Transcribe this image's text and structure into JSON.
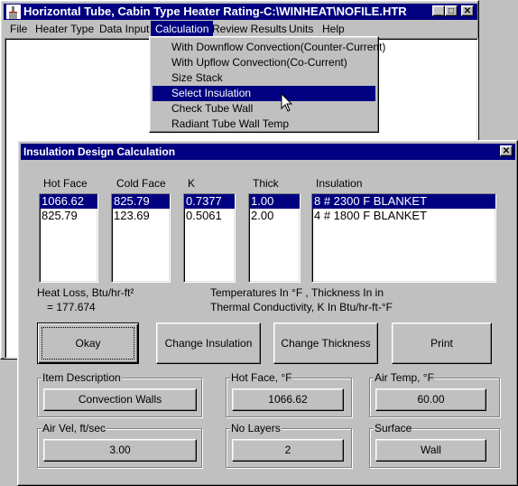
{
  "main_window": {
    "title": "Horizontal Tube, Cabin Type Heater Rating-C:\\WINHEAT\\NOFILE.HTR",
    "controls": {
      "minimize": "_",
      "maximize": "□",
      "close": "✕"
    },
    "menu": [
      "File",
      "Heater Type",
      "Data Input",
      "Calculation",
      "Review Results",
      "Units",
      "Help"
    ],
    "active_menu": "Calculation"
  },
  "calculation_menu": {
    "items": [
      "With Downflow Convection(Counter-Current)",
      "With Upflow Convection(Co-Current)",
      "Size Stack",
      "Select Insulation",
      "Check Tube Wall",
      "Radiant Tube Wall Temp"
    ],
    "selected": "Select Insulation"
  },
  "dialog": {
    "title": "Insulation Design Calculation",
    "close": "✕",
    "columns": {
      "hot_face": {
        "header": "Hot Face",
        "values": [
          "1066.62",
          "825.79"
        ]
      },
      "cold_face": {
        "header": "Cold Face",
        "values": [
          "825.79",
          "123.69"
        ]
      },
      "k": {
        "header": "K",
        "values": [
          "0.7377",
          "0.5061"
        ]
      },
      "thick": {
        "header": "Thick",
        "values": [
          "1.00",
          "2.00"
        ]
      },
      "insulation": {
        "header": "Insulation",
        "values": [
          "8 # 2300 F BLANKET",
          "4 # 1800 F BLANKET"
        ]
      }
    },
    "heat_loss_label": "Heat Loss, Btu/hr-ft²",
    "heat_loss_value": "= 177.674",
    "units_note_1": "Temperatures In °F , Thickness In in",
    "units_note_2": "Thermal Conductivity, K In Btu/hr-ft-°F",
    "buttons": {
      "okay": "Okay",
      "change_insulation": "Change Insulation",
      "change_thickness": "Change Thickness",
      "print": "Print"
    },
    "fields": {
      "item_description": {
        "label": "Item Description",
        "value": "Convection Walls"
      },
      "hot_face": {
        "label": "Hot Face, °F",
        "value": "1066.62"
      },
      "air_temp": {
        "label": "Air Temp, °F",
        "value": "60.00"
      },
      "air_vel": {
        "label": "Air Vel, ft/sec",
        "value": "3.00"
      },
      "no_layers": {
        "label": "No Layers",
        "value": "2"
      },
      "surface": {
        "label": "Surface",
        "value": "Wall"
      }
    }
  }
}
